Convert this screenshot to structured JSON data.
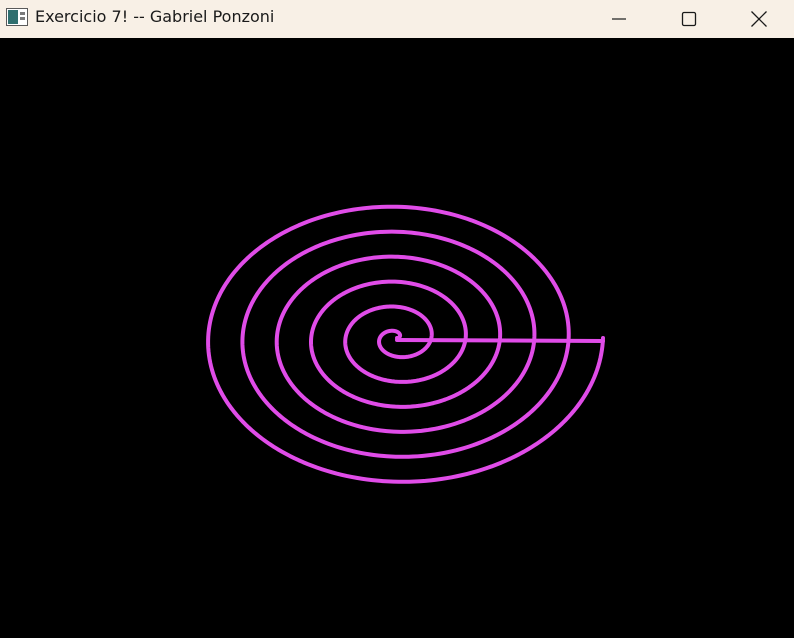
{
  "window": {
    "title": "Exercicio 7! -- Gabriel Ponzoni",
    "controls": {
      "minimize_icon": "minimize-icon",
      "maximize_icon": "maximize-icon",
      "close_icon": "close-icon"
    }
  },
  "canvas": {
    "background": "#000000",
    "spiral": {
      "color": "#e04ce8",
      "turns": 6,
      "shape": "elliptical spiral",
      "has_horizontal_radius_line": true
    }
  }
}
